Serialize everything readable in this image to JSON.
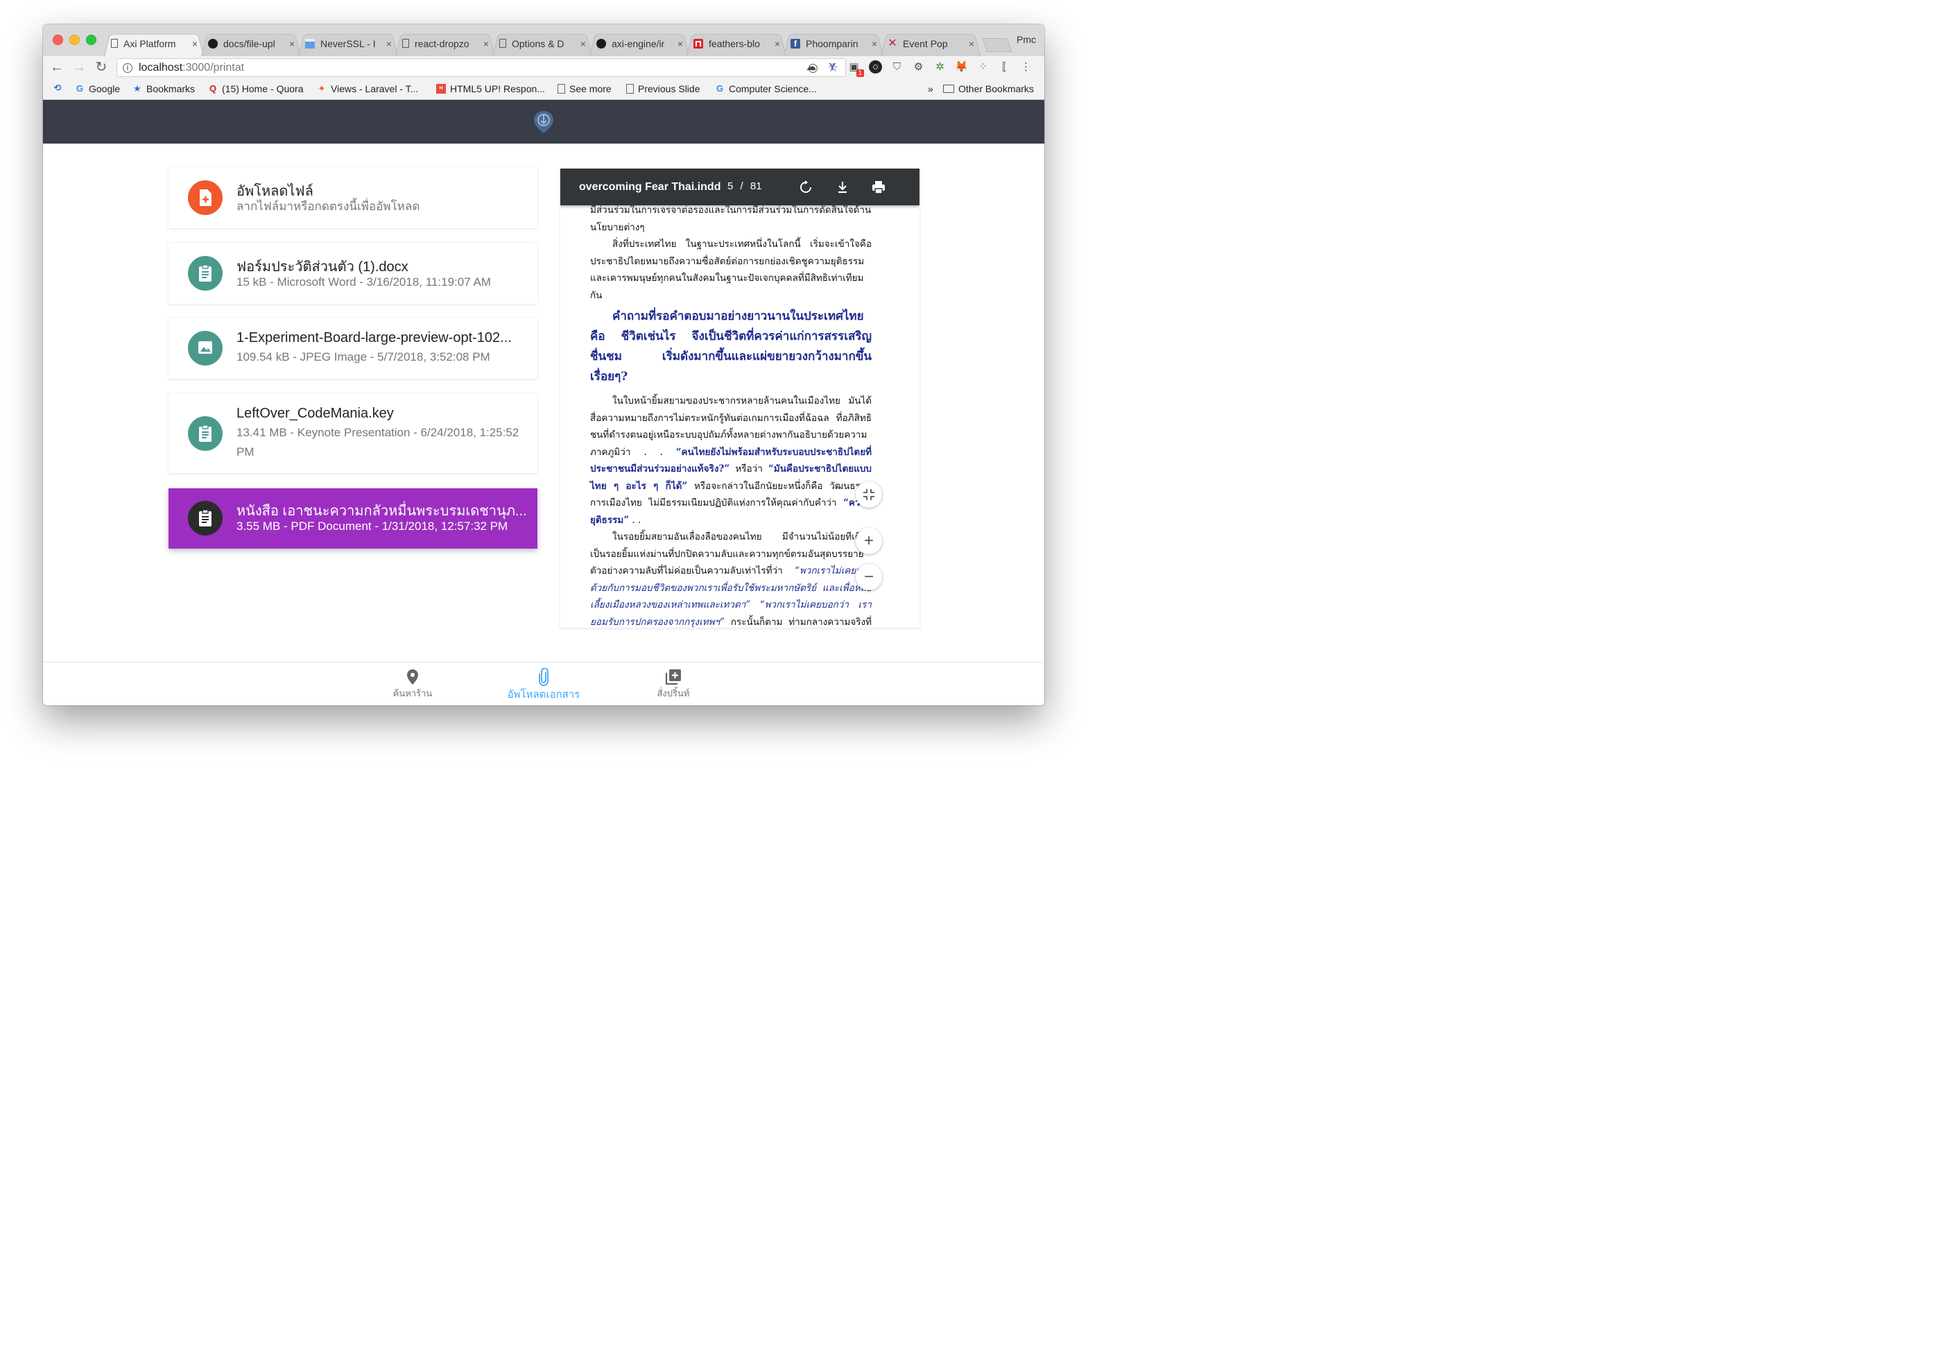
{
  "browser": {
    "tabs": [
      {
        "label": "Axi Platform",
        "favicon": "page-icon",
        "active": true
      },
      {
        "label": "docs/file-upl",
        "favicon": "github-icon"
      },
      {
        "label": "NeverSSL - I",
        "favicon": "neverssl-icon"
      },
      {
        "label": "react-dropzo",
        "favicon": "page-icon"
      },
      {
        "label": "Options & D",
        "favicon": "page-icon"
      },
      {
        "label": "axi-engine/ir",
        "favicon": "github-icon"
      },
      {
        "label": "feathers-blo",
        "favicon": "feathers-icon"
      },
      {
        "label": "Phoomparin",
        "favicon": "facebook-icon"
      },
      {
        "label": "Event Pop",
        "favicon": "eventpop-icon"
      }
    ],
    "tab_close": "×",
    "profile": "Pmc",
    "url_host": "localhost",
    "url_path": ":3000/printat",
    "bookmarks": [
      {
        "label": "Google",
        "icon": "google-icon"
      },
      {
        "label": "Bookmarks",
        "icon": "star-icon"
      },
      {
        "label": "(15) Home - Quora",
        "icon": "quora-icon"
      },
      {
        "label": "Views - Laravel - T...",
        "icon": "laravel-icon"
      },
      {
        "label": "HTML5 UP! Respon...",
        "icon": "html5up-icon"
      },
      {
        "label": "See more",
        "icon": "page-icon"
      },
      {
        "label": "Previous Slide",
        "icon": "page-icon"
      },
      {
        "label": "Computer Science...",
        "icon": "google-icon"
      }
    ],
    "bookmarks_overflow": "»",
    "other_bookmarks": "Other Bookmarks",
    "badge_count": "1"
  },
  "upload": {
    "title": "อัพโหลดไฟล์",
    "subtitle": "ลากไฟล์มาหรือกดตรงนี้เพื่ออัพโหลด",
    "color": "#f0592b"
  },
  "files": [
    {
      "name": "ฟอร์มประวัติส่วนตัว (1).docx",
      "meta": "15 kB - Microsoft Word - 3/16/2018, 11:19:07 AM",
      "icon": "clipboard-icon",
      "color": "#4a9a8c"
    },
    {
      "name": "1-Experiment-Board-large-preview-opt-102...",
      "meta": "109.54 kB - JPEG Image - 5/7/2018, 3:52:08 PM",
      "icon": "image-icon",
      "color": "#4a9a8c"
    },
    {
      "name": "LeftOver_CodeMania.key",
      "meta": "13.41 MB - Keynote Presentation - 6/24/2018, 1:25:52 PM",
      "icon": "clipboard-icon",
      "color": "#4a9a8c"
    },
    {
      "name": "หนังสือ เอาชนะความกลัวหมื่นพระบรมเดชานุภ...",
      "meta": "3.55 MB - PDF Document - 1/31/2018, 12:57:32 PM",
      "icon": "clipboard-icon",
      "color": "#2b2b2b",
      "selected": true,
      "selected_color": "#9c2fc1"
    }
  ],
  "pdf": {
    "filename": "overcoming Fear Thai.indd",
    "page": "5",
    "separator": "/",
    "total": "81",
    "text": {
      "p0": "มีส่วนร่วมในการเจรจาต่อรองและในการมีส่วนร่วมในการตัดสินใจด้าน",
      "p0b": "นโยบายต่างๆ",
      "p1": "สิ่งที่ประเทศไทย ในฐานะประเทศหนึ่งในโลกนี้ เริ่มจะเข้าใจคือประชาธิปไตยหมายถึงความซื่อสัตย์ต่อการยกย่องเชิดชูความยุติธรรมและเคารพมนุษย์ทุกคนในสังคมในฐานะปัจเจกบุคคลที่มีสิทธิเท่าเทียมกัน",
      "quote": "คำถามที่รอคำตอบมาอย่างยาวนานในประเทศไทยคือ ชีวิตเช่นไร จึงเป็นชีวิตที่ควรค่าแก่การสรรเสริญชื่นชม เริ่มดังมากขึ้นและแผ่ขยายวงกว้างมากขึ้นเรื่อยๆ?",
      "p2a": "ในใบหน้ายิ้มสยามของประชากรหลายล้านคนในเมืองไทย มันได้สื่อความหมายถึงการไม่ตระหนักรู้ทันต่อเกมการเมืองที่ฉ้อฉล ที่อภิสิทธิชนที่ดำรงตนอยู่เหนือระบบอุปถัมภ์ทั้งหลายต่างพากันอธิบายด้วยความภาคภูมิว่า . . ",
      "p2b": "“คนไทยยังไม่พร้อมสำหรับระบอบประชาธิปไตยที่ประชาชนมีส่วนร่วมอย่างแท้จริง?”",
      "p2c": " หรือว่า ",
      "p2d": "“มันคือประชาธิปไตยแบบไทย ๆ อะไร ๆ ก็ได้”",
      "p2e": " หรือจะกล่าวในอีกนัยยะหนึ่งก็คือ วัฒนธรรมการเมืองไทย ไม่มีธรรมเนียมปฏิบัติแห่งการให้คุณค่ากับคำว่า ",
      "p2f": "“ความยุติธรรม”",
      "p2g": " . .",
      "p3a": "ในรอยยิ้มสยามอันเลื่องลือของคนไทย มีจำนวนไม่น้อยทีเดียว เป็นรอยยิ้มแห่งม่านที่ปกปิดความลับและความทุกข์ตรมอันสุดบรรยายตัวอย่างความลับที่ไม่ค่อยเป็นความลับเท่าไรที่ว่า ",
      "p3b": "“พวกเราไม่เคยเห็นด้วยกับการมอบชีวิตของพวกเราเพื่อรับใช้พระมหากษัตริย์ และเพื่อหล่อเลี้ยงเมืองหลวงของเหล่าเทพและเทวดา” “พวกเราไม่เคยบอกว่า เรายอมรับการปกครองจากกรุงเทพฯ”",
      "p3c": " กระนั้นก็ตาม ท่ามกลางความจริงที่ถูกปกปิดไว้ พวกเขาก็คงยังคงมีบางขณะเวลาที่สามารถหัวเราะด้วยความใสซื่อได้บ้างเหมือนกัน"
    },
    "zoom_fit": "fit-icon",
    "zoom_in": "+",
    "zoom_out": "−"
  },
  "bottom_nav": [
    {
      "label": "ค้นหาร้าน",
      "icon": "map-pin-icon"
    },
    {
      "label": "อัพโหลดเอกสาร",
      "icon": "paperclip-icon",
      "active": true
    },
    {
      "label": "สั่งปริ้นท์",
      "icon": "add-to-queue-icon"
    }
  ],
  "colors": {
    "header": "#383d47",
    "accent": "#42a5f5",
    "selected": "#9c2fc1",
    "upload": "#f0592b",
    "teal": "#4a9a8c"
  }
}
